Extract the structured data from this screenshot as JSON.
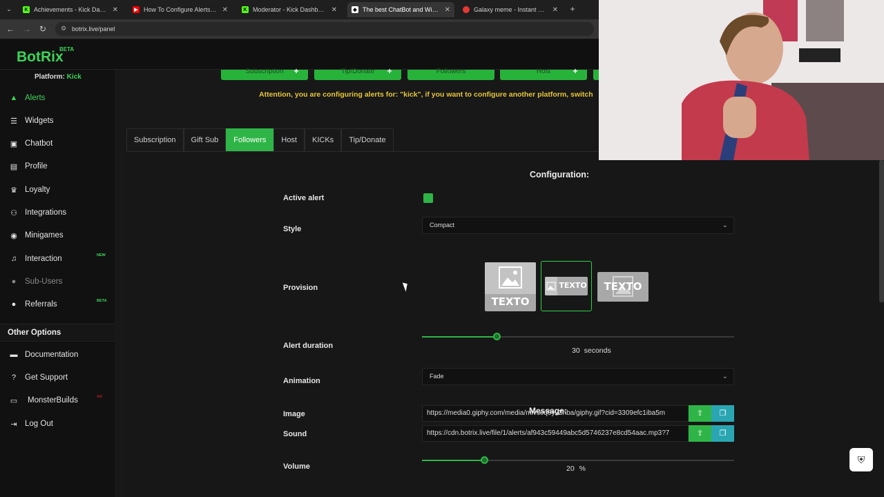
{
  "browser": {
    "tabs": [
      {
        "title": "Achievements - Kick Dashboard",
        "icon": "kick-icon",
        "color": "#53fc18",
        "active": false
      },
      {
        "title": "How To Configure Alerts For Kic",
        "icon": "youtube-icon",
        "color": "#ff0000",
        "active": false
      },
      {
        "title": "Moderator - Kick Dashboard",
        "icon": "kick-icon",
        "color": "#53fc18",
        "active": false
      },
      {
        "title": "The best ChatBot and Widgets",
        "icon": "botrix-icon",
        "color": "#ffffff",
        "active": true
      },
      {
        "title": "Galaxy meme - Instant Sound E",
        "icon": "sound-icon",
        "color": "#e53935",
        "active": false
      }
    ],
    "new_tab": "+",
    "url": "botrix.live/panel"
  },
  "app": {
    "logo": "BotRix",
    "beta": "BETA",
    "accent": "#2fb547"
  },
  "sidebar": {
    "platform_label": "Platform:",
    "platform_value": "Kick",
    "items": [
      {
        "label": "Alerts",
        "icon": "warning-icon",
        "active": true
      },
      {
        "label": "Widgets",
        "icon": "list-icon"
      },
      {
        "label": "Chatbot",
        "icon": "robot-icon"
      },
      {
        "label": "Profile",
        "icon": "id-card-icon"
      },
      {
        "label": "Loyalty",
        "icon": "trophy-icon"
      },
      {
        "label": "Integrations",
        "icon": "plug-icon"
      },
      {
        "label": "Minigames",
        "icon": "gamepad-icon"
      },
      {
        "label": "Interaction",
        "icon": "music-icon",
        "badge": "NEW"
      },
      {
        "label": "Sub-Users",
        "icon": "users-icon",
        "dim": true
      },
      {
        "label": "Referrals",
        "icon": "user-group-icon",
        "badge": "BETA"
      }
    ],
    "other_options": "Other Options",
    "other_items": [
      {
        "label": "Documentation",
        "icon": "book-icon"
      },
      {
        "label": "Get Support",
        "icon": "question-icon"
      },
      {
        "label": "MonsterBuilds",
        "icon": "monitor-icon",
        "badge": "AD"
      },
      {
        "label": "Log Out",
        "icon": "logout-icon"
      }
    ]
  },
  "topbar": {
    "buttons": [
      "Subscription",
      "Tip/Donate",
      "Followers",
      "Host"
    ],
    "attention": "Attention, you are configuring alerts for: \"kick\", if you want to configure another platform, switch"
  },
  "alert_tabs": [
    "Subscription",
    "Gift Sub",
    "Followers",
    "Host",
    "KICKs",
    "Tip/Donate"
  ],
  "active_tab": "Followers",
  "config": {
    "title": "Configuration:",
    "active_alert_label": "Active alert",
    "active_alert_value": true,
    "style_label": "Style",
    "style_value": "Compact",
    "provision_label": "Provision",
    "provision_text": "TEXTO",
    "provision_selected": 2,
    "duration_label": "Alert duration",
    "duration_value": "30",
    "duration_unit": "seconds",
    "duration_fraction": 0.24,
    "animation_label": "Animation",
    "animation_value": "Fade",
    "image_label": "Image",
    "image_url": "https://media0.giphy.com/media/mlvseq9yvZhba/giphy.gif?cid=3309efc1iba5m",
    "sound_label": "Sound",
    "sound_url": "https://cdn.botrix.live/file/1/alerts/af943c59449abc5d5746237e8cd54aac.mp3?7",
    "volume_label": "Volume",
    "volume_value": "20",
    "volume_unit": "%",
    "volume_fraction": 0.2,
    "message_title": "Message:"
  }
}
